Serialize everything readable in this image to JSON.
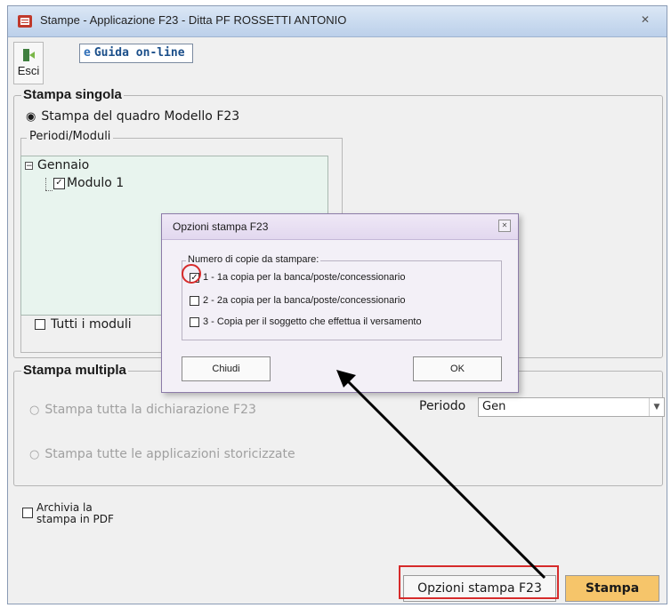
{
  "window": {
    "title": "Stampe - Applicazione F23 - Ditta PF ROSSETTI ANTONIO",
    "close_glyph": "✕"
  },
  "toolbar": {
    "esci_label": "Esci",
    "guida_label": "Guida on-line",
    "guida_icon": "e"
  },
  "stampa_singola": {
    "title": "Stampa singola",
    "radio_label": "Stampa del quadro Modello F23",
    "periodi_title": "Periodi/Moduli",
    "tree": {
      "expander": "−",
      "parent": "Gennaio",
      "child": "Modulo 1",
      "child_checked": "✓"
    },
    "tutti_moduli": "Tutti i moduli"
  },
  "stampa_multipla": {
    "title": "Stampa multipla",
    "radio1": "Stampa tutta la dichiarazione F23",
    "radio2": "Stampa tutte le applicazioni storicizzate",
    "periodo_label": "Periodo",
    "periodo_value": "Gen"
  },
  "archivia": {
    "line1": "Archivia la",
    "line2": "stampa in PDF"
  },
  "buttons": {
    "opzioni": "Opzioni stampa F23",
    "stampa": "Stampa"
  },
  "dialog": {
    "title": "Opzioni stampa F23",
    "close_glyph": "✕",
    "group_title": "Numero di copie da stampare:",
    "options": [
      {
        "label": "1 - 1a copia per la banca/poste/concessionario",
        "checked": "✓"
      },
      {
        "label": "2 - 2a copia per la banca/poste/concessionario",
        "checked": ""
      },
      {
        "label": "3 - Copia per il soggetto che effettua il versamento",
        "checked": ""
      }
    ],
    "chiudi": "Chiudi",
    "ok": "OK"
  },
  "colors": {
    "stampa_button_bg": "#f6c56a",
    "annotation_red": "#d62b2b",
    "tree_bg": "#e8f4ee"
  }
}
